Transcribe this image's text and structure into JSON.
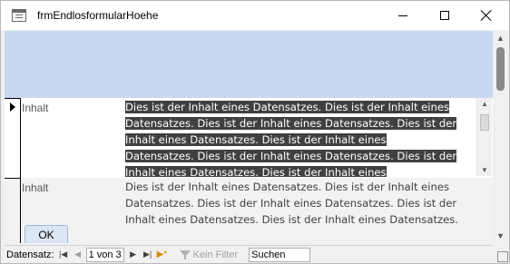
{
  "window": {
    "title": "frmEndlosformularHoehe"
  },
  "records": [
    {
      "label": "Inhalt",
      "content": "Dies ist der Inhalt eines Datensatzes. Dies ist der Inhalt eines Datensatzes. Dies ist der Inhalt eines Datensatzes. Dies ist der Inhalt eines Datensatzes. Dies ist der Inhalt eines Datensatzes. Dies ist der Inhalt eines Datensatzes. Dies ist der Inhalt eines Datensatzes. Dies ist der Inhalt eines Datensatzes."
    },
    {
      "label": "Inhalt",
      "content": "Dies ist der Inhalt eines Datensatzes. Dies ist der Inhalt eines Datensatzes. Dies ist der Inhalt eines Datensatzes. Dies ist der Inhalt eines Datensatzes. Dies ist der Inhalt eines Datensatzes."
    }
  ],
  "buttons": {
    "ok": "OK"
  },
  "navigation": {
    "label": "Datensatz:",
    "position": "1 von 3",
    "filter": "Kein Filter",
    "search": "Suchen"
  },
  "icons": {
    "first": "first-record-icon",
    "prev": "previous-record-icon",
    "next": "next-record-icon",
    "last": "last-record-icon",
    "new": "new-record-icon",
    "filter": "filter-icon"
  }
}
